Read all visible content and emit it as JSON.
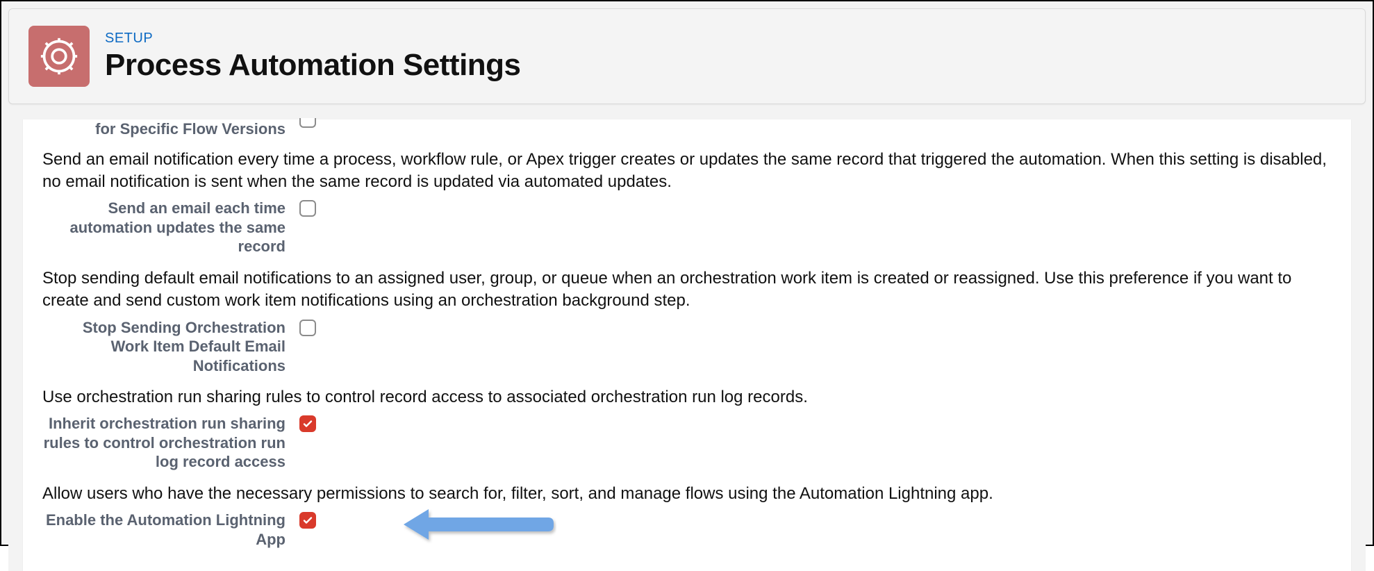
{
  "header": {
    "eyebrow": "SETUP",
    "title": "Process Automation Settings"
  },
  "topPartial": {
    "label": "for Specific Flow Versions"
  },
  "settings": [
    {
      "desc": "Send an email notification every time a process, workflow rule, or Apex trigger creates or updates the same record that triggered the automation. When this setting is disabled, no email notification is sent when the same record is updated via automated updates.",
      "label": "Send an email each time automation updates the same record",
      "checked": false
    },
    {
      "desc": "Stop sending default email notifications to an assigned user, group, or queue when an orchestration work item is created or reassigned. Use this preference if you want to create and send custom work item notifications using an orchestration background step.",
      "label": "Stop Sending Orchestration Work Item Default Email Notifications",
      "checked": false
    },
    {
      "desc": "Use orchestration run sharing rules to control record access to associated orchestration run log records.",
      "label": "Inherit orchestration run sharing rules to control orchestration run log record access",
      "checked": true
    },
    {
      "desc": "Allow users who have the necessary permissions to search for, filter, sort, and manage flows using the Automation Lightning app.",
      "label": "Enable the Automation Lightning App",
      "checked": true
    }
  ]
}
